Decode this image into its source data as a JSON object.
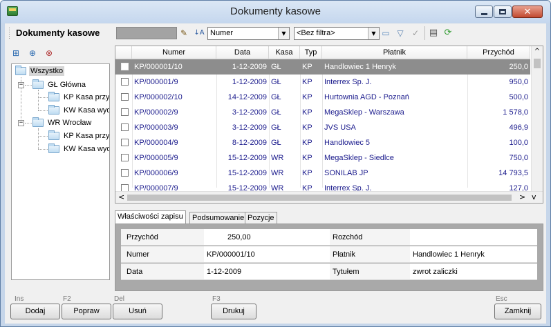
{
  "window": {
    "title": "Dokumenty kasowe"
  },
  "toolbar": {
    "form_title": "Dokumenty kasowe",
    "sort_combo": "Numer",
    "filter_combo": "<Bez filtra>",
    "icons": [
      "eraser-icon",
      "sort-icon",
      "folder-icon",
      "filter-icon",
      "check-icon",
      "grid-view-icon",
      "refresh-icon"
    ]
  },
  "tree": {
    "items": [
      {
        "label": "Wszystko"
      },
      {
        "label": "GŁ Główna"
      },
      {
        "label": "KP Kasa przyjęć"
      },
      {
        "label": "KW Kasa wydatków"
      },
      {
        "label": "WR Wrocław"
      },
      {
        "label": "KP Kasa przyjęć"
      },
      {
        "label": "KW Kasa wydatków"
      }
    ]
  },
  "grid": {
    "columns": [
      "Numer",
      "Data",
      "Kasa",
      "Typ",
      "Płatnik",
      "Przychód"
    ],
    "rows": [
      [
        "KP/000001/10",
        "1-12-2009",
        "GŁ",
        "KP",
        "Handlowiec 1 Henryk",
        "250,0"
      ],
      [
        "KP/000001/9",
        "1-12-2009",
        "GŁ",
        "KP",
        "Interrex Sp. J.",
        "950,0"
      ],
      [
        "KP/000002/10",
        "14-12-2009",
        "GŁ",
        "KP",
        "Hurtownia AGD - Poznań",
        "500,0"
      ],
      [
        "KP/000002/9",
        "3-12-2009",
        "GŁ",
        "KP",
        "MegaSklep - Warszawa",
        "1 578,0"
      ],
      [
        "KP/000003/9",
        "3-12-2009",
        "GŁ",
        "KP",
        "JVS USA",
        "496,9"
      ],
      [
        "KP/000004/9",
        "8-12-2009",
        "GŁ",
        "KP",
        "Handlowiec 5",
        "100,0"
      ],
      [
        "KP/000005/9",
        "15-12-2009",
        "WR",
        "KP",
        "MegaSklep - Siedlce",
        "750,0"
      ],
      [
        "KP/000006/9",
        "15-12-2009",
        "WR",
        "KP",
        "SONILAB JP",
        "14 793,5"
      ],
      [
        "KP/000007/9",
        "15-12-2009",
        "WR",
        "KP",
        "Interrex Sp. J.",
        "127,0"
      ]
    ]
  },
  "tabs": [
    "Właściwości zapisu",
    "Podsumowanie",
    "Pozycje"
  ],
  "details": {
    "przychod_label": "Przychód",
    "przychod_value": "250,00",
    "rozchod_label": "Rozchód",
    "rozchod_value": "",
    "numer_label": "Numer",
    "numer_value": "KP/000001/10",
    "platnik_label": "Płatnik",
    "platnik_value": "Handlowiec 1 Henryk",
    "data_label": "Data",
    "data_value": "1-12-2009",
    "tytulem_label": "Tytułem",
    "tytulem_value": "zwrot zaliczki"
  },
  "buttons": {
    "dodaj": {
      "key": "Ins",
      "label": "Dodaj"
    },
    "popraw": {
      "key": "F2",
      "label": "Popraw"
    },
    "usun": {
      "key": "Del",
      "label": "Usuń"
    },
    "drukuj": {
      "key": "F3",
      "label": "Drukuj"
    },
    "zamknij": {
      "key": "Esc",
      "label": "Zamknij"
    }
  }
}
